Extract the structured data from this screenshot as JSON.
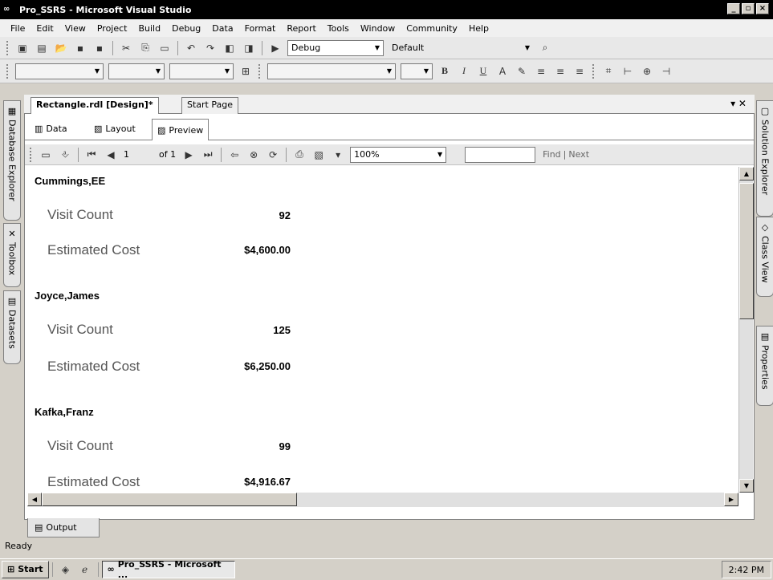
{
  "window": {
    "title": "Pro_SSRS - Microsoft Visual Studio"
  },
  "menu": [
    "File",
    "Edit",
    "View",
    "Project",
    "Build",
    "Debug",
    "Data",
    "Format",
    "Report",
    "Tools",
    "Window",
    "Community",
    "Help"
  ],
  "toolbar1": {
    "config": "Debug",
    "platform": "Default"
  },
  "toolbar2": {
    "bold": "B",
    "italic": "I",
    "underline": "U"
  },
  "side_left": [
    "Database Explorer",
    "Toolbox",
    "Datasets"
  ],
  "side_right": [
    "Solution Explorer",
    "Class View",
    "Properties"
  ],
  "doc_tabs": [
    "Rectangle.rdl [Design]*",
    "Start Page"
  ],
  "sub_tabs": [
    "Data",
    "Layout",
    "Preview"
  ],
  "report_toolbar": {
    "page": "1",
    "of_pages": "of 1",
    "zoom": "100%",
    "find_placeholder": "",
    "find_label": "Find",
    "next_label": "Next"
  },
  "records": [
    {
      "name": "Cummings,EE",
      "visit_label": "Visit Count",
      "visit": "92",
      "cost_label": "Estimated Cost",
      "cost": "$4,600.00"
    },
    {
      "name": "Joyce,James",
      "visit_label": "Visit Count",
      "visit": "125",
      "cost_label": "Estimated Cost",
      "cost": "$6,250.00"
    },
    {
      "name": "Kafka,Franz",
      "visit_label": "Visit Count",
      "visit": "99",
      "cost_label": "Estimated Cost",
      "cost": "$4,916.67"
    }
  ],
  "output_tab": "Output",
  "status": "Ready",
  "taskbar": {
    "start": "Start",
    "task": "Pro_SSRS - Microsoft ...",
    "clock": "2:42 PM"
  }
}
